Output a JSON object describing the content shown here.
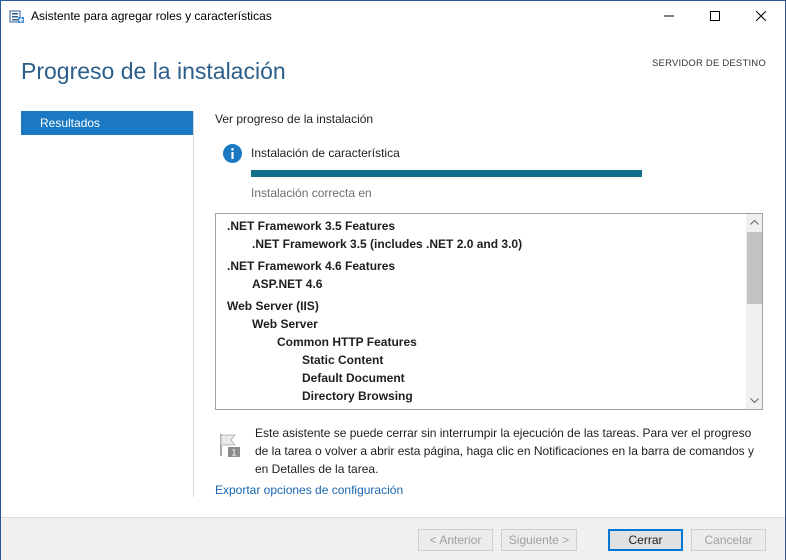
{
  "window": {
    "title": "Asistente para agregar roles y características",
    "icon": "server-manager-icon"
  },
  "header": {
    "page_title": "Progreso de la instalación",
    "destination_server": "SERVIDOR DE DESTINO"
  },
  "nav": {
    "items": [
      {
        "label": "Resultados",
        "selected": true
      }
    ]
  },
  "main": {
    "view_progress": "Ver progreso de la instalación",
    "status_title": "Instalación de característica",
    "status_icon": "info-icon",
    "progress": 1.0,
    "result_text": "Instalación correcta en",
    "tree": [
      {
        "label": ".NET Framework 3.5 Features",
        "level": 0
      },
      {
        "label": ".NET Framework 3.5 (includes .NET 2.0 and 3.0)",
        "level": 1
      },
      {
        "label": ".NET Framework 4.6 Features",
        "level": 0
      },
      {
        "label": "ASP.NET 4.6",
        "level": 1
      },
      {
        "label": "Web Server (IIS)",
        "level": 0
      },
      {
        "label": "Web Server",
        "level": 1
      },
      {
        "label": "Common HTTP Features",
        "level": 2
      },
      {
        "label": "Static Content",
        "level": 3
      },
      {
        "label": "Default Document",
        "level": 3
      },
      {
        "label": "Directory Browsing",
        "level": 3
      }
    ],
    "note": "Este asistente se puede cerrar sin interrumpir la ejecución de las tareas. Para ver el progreso de la tarea o volver a abrir esta página, haga clic en Notificaciones en la barra de comandos y en Detalles de la tarea.",
    "note_icon": "notification-flag-icon",
    "export_link": "Exportar opciones de configuración"
  },
  "footer": {
    "prev_label": "< Anterior",
    "next_label": "Siguiente >",
    "close_label": "Cerrar",
    "cancel_label": "Cancelar"
  },
  "colors": {
    "accent": "#1a79c2",
    "title": "#2b5f8a",
    "progress": "#12708a",
    "link": "#1a66b0"
  }
}
